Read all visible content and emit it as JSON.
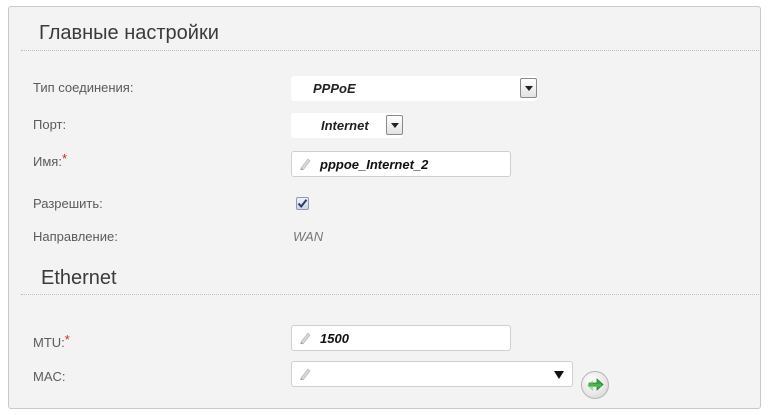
{
  "main_settings": {
    "title": "Главные настройки",
    "connection_type": {
      "label": "Тип соединения:",
      "value": "PPPoE"
    },
    "port": {
      "label": "Порт:",
      "value": "Internet"
    },
    "name": {
      "label": "Имя:",
      "required_mark": "*",
      "value": "pppoe_Internet_2"
    },
    "enable": {
      "label": "Разрешить:",
      "checked": true
    },
    "direction": {
      "label": "Направление:",
      "value": "WAN"
    }
  },
  "ethernet": {
    "title": "Ethernet",
    "mtu": {
      "label": "MTU:",
      "required_mark": "*",
      "value": "1500"
    },
    "mac": {
      "label": "MAC:",
      "value": ""
    }
  },
  "colors": {
    "required": "#e0201a",
    "refresh_green": "#3aa83a"
  },
  "icons": {
    "pencil": "pencil-icon",
    "refresh": "refresh-icon",
    "dropdown": "chevron-down-icon"
  }
}
